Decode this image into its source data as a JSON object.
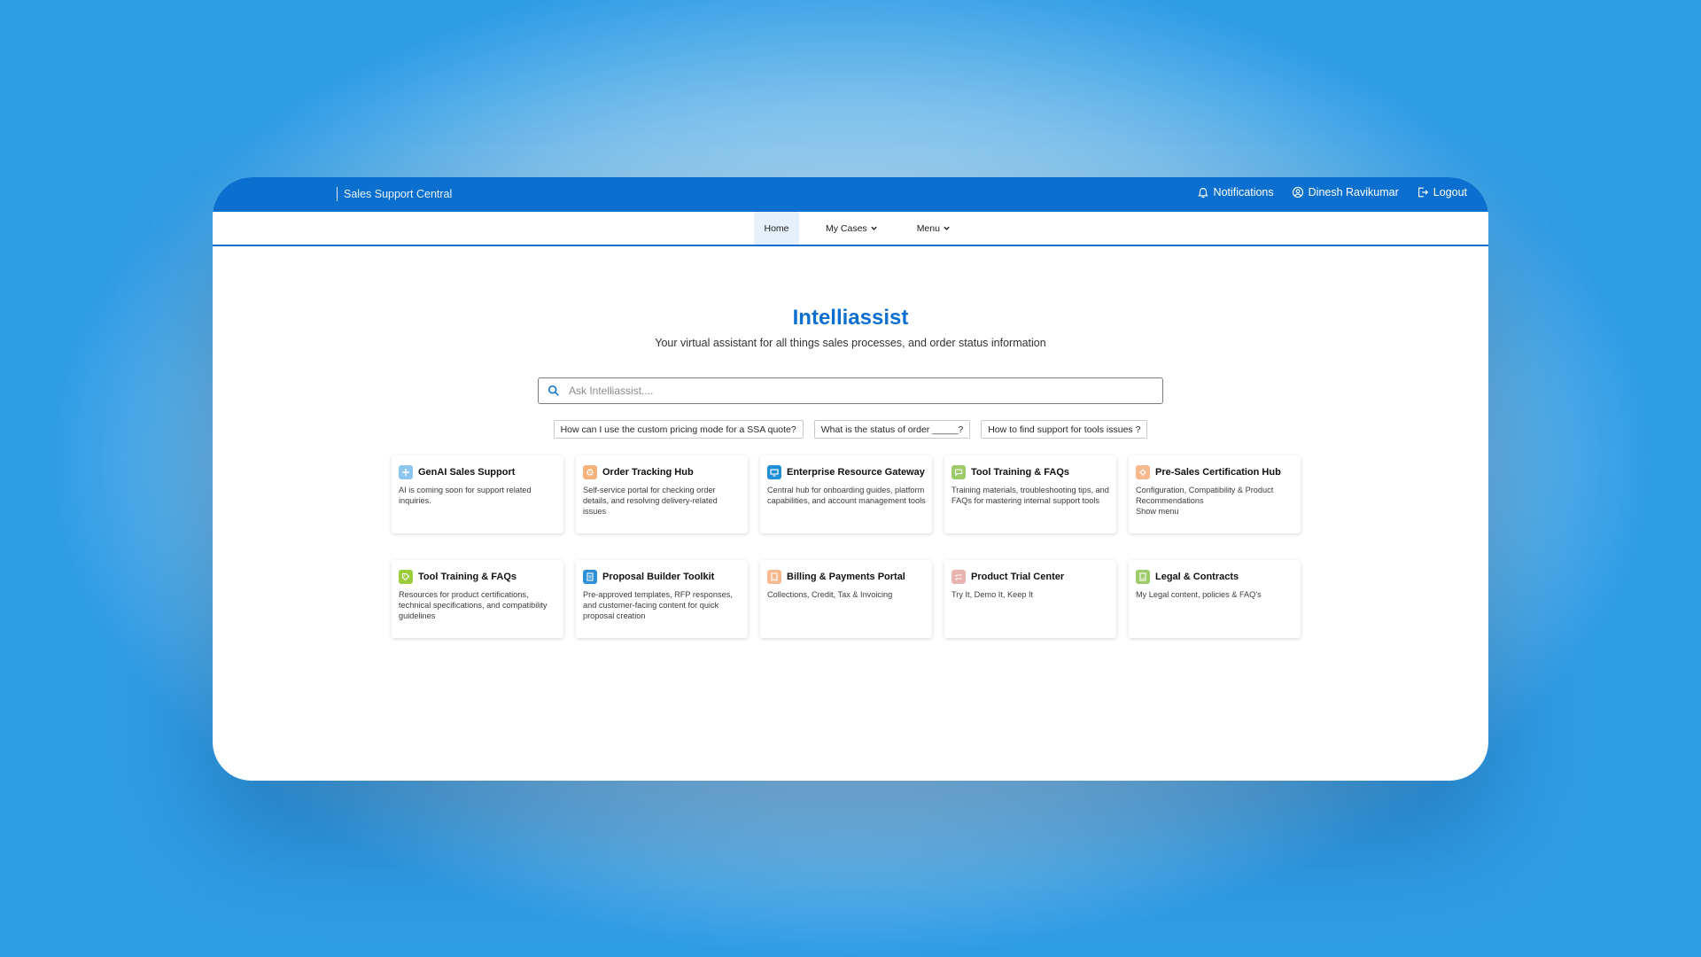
{
  "header": {
    "brand": "Sales Support Central",
    "notifications": "Notifications",
    "user": "Dinesh Ravikumar",
    "logout": "Logout"
  },
  "nav": {
    "home": "Home",
    "my_cases": "My Cases",
    "menu": "Menu"
  },
  "hero": {
    "title": "Intelliassist",
    "subtitle": "Your virtual assistant for all things sales processes, and order status information"
  },
  "search": {
    "placeholder": "Ask Intelliassist...."
  },
  "suggestions": [
    "How can I use the custom pricing mode for a SSA quote?",
    "What is the status of order _____?",
    "How to find support for tools issues ?"
  ],
  "cards": [
    {
      "title": "GenAI Sales Support",
      "desc": "AI is coming soon for support related inquiries.",
      "icon": "sparkle-icon",
      "color": "#8cc6ee"
    },
    {
      "title": "Order Tracking Hub",
      "desc": "Self-service portal for checking order details, and resolving delivery-related issues",
      "icon": "tracking-icon",
      "color": "#f4b27c"
    },
    {
      "title": "Enterprise Resource Gateway",
      "desc": "Central hub for onboarding guides, platform capabilities, and account management tools",
      "icon": "monitor-icon",
      "color": "#1f8fd8"
    },
    {
      "title": "Tool Training & FAQs",
      "desc": "Training materials, troubleshooting tips, and FAQs for mastering internal support tools",
      "icon": "chat-icon",
      "color": "#9ccb6a"
    },
    {
      "title": "Pre-Sales Certification Hub",
      "desc": "Configuration, Compatibility & Product Recommendations\nShow menu",
      "icon": "settings-icon",
      "color": "#f6b98e"
    },
    {
      "title": "Tool Training & FAQs",
      "desc": "Resources for product certifications, technical specifications, and compatibility guidelines",
      "icon": "tag-icon",
      "color": "#9ccb3c"
    },
    {
      "title": "Proposal Builder Toolkit",
      "desc": "Pre-approved templates, RFP responses, and customer-facing content for quick proposal creation",
      "icon": "document-icon",
      "color": "#2e90d6"
    },
    {
      "title": "Billing & Payments Portal",
      "desc": "Collections, Credit, Tax & Invoicing",
      "icon": "invoice-icon",
      "color": "#f6b98e"
    },
    {
      "title": "Product Trial Center",
      "desc": "Try It, Demo It, Keep It",
      "icon": "checklist-icon",
      "color": "#e8b4b0"
    },
    {
      "title": "Legal & Contracts",
      "desc": "My Legal content, policies & FAQ's",
      "icon": "legal-icon",
      "color": "#9ccb6a"
    }
  ]
}
